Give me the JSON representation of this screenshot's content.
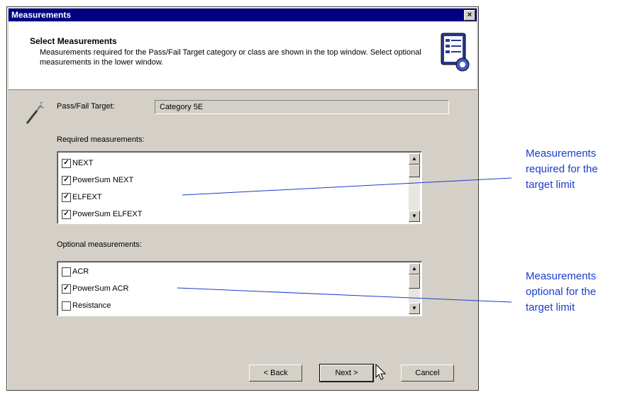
{
  "window": {
    "title": "Measurements"
  },
  "header": {
    "title": "Select Measurements",
    "description": "Measurements required for the Pass/Fail Target category or class are shown in the top window. Select optional measurements in the lower window."
  },
  "target": {
    "label": "Pass/Fail Target:",
    "value": "Category 5E"
  },
  "required": {
    "label": "Required measurements:",
    "items": [
      {
        "label": "NEXT",
        "checked": true
      },
      {
        "label": "PowerSum NEXT",
        "checked": true
      },
      {
        "label": "ELFEXT",
        "checked": true
      },
      {
        "label": "PowerSum ELFEXT",
        "checked": true
      }
    ]
  },
  "optional": {
    "label": "Optional measurements:",
    "items": [
      {
        "label": "ACR",
        "checked": false
      },
      {
        "label": "PowerSum ACR",
        "checked": true
      },
      {
        "label": "Resistance",
        "checked": false
      }
    ]
  },
  "buttons": {
    "back": "< Back",
    "next": "Next >",
    "cancel": "Cancel"
  },
  "callouts": {
    "required": [
      "Measurements",
      "required for the",
      "target limit"
    ],
    "optional": [
      "Measurements",
      "optional for the",
      "target limit"
    ]
  },
  "colors": {
    "titlebar": "#000080",
    "callout": "#1a3ccc",
    "dialog": "#d4d0c8"
  }
}
